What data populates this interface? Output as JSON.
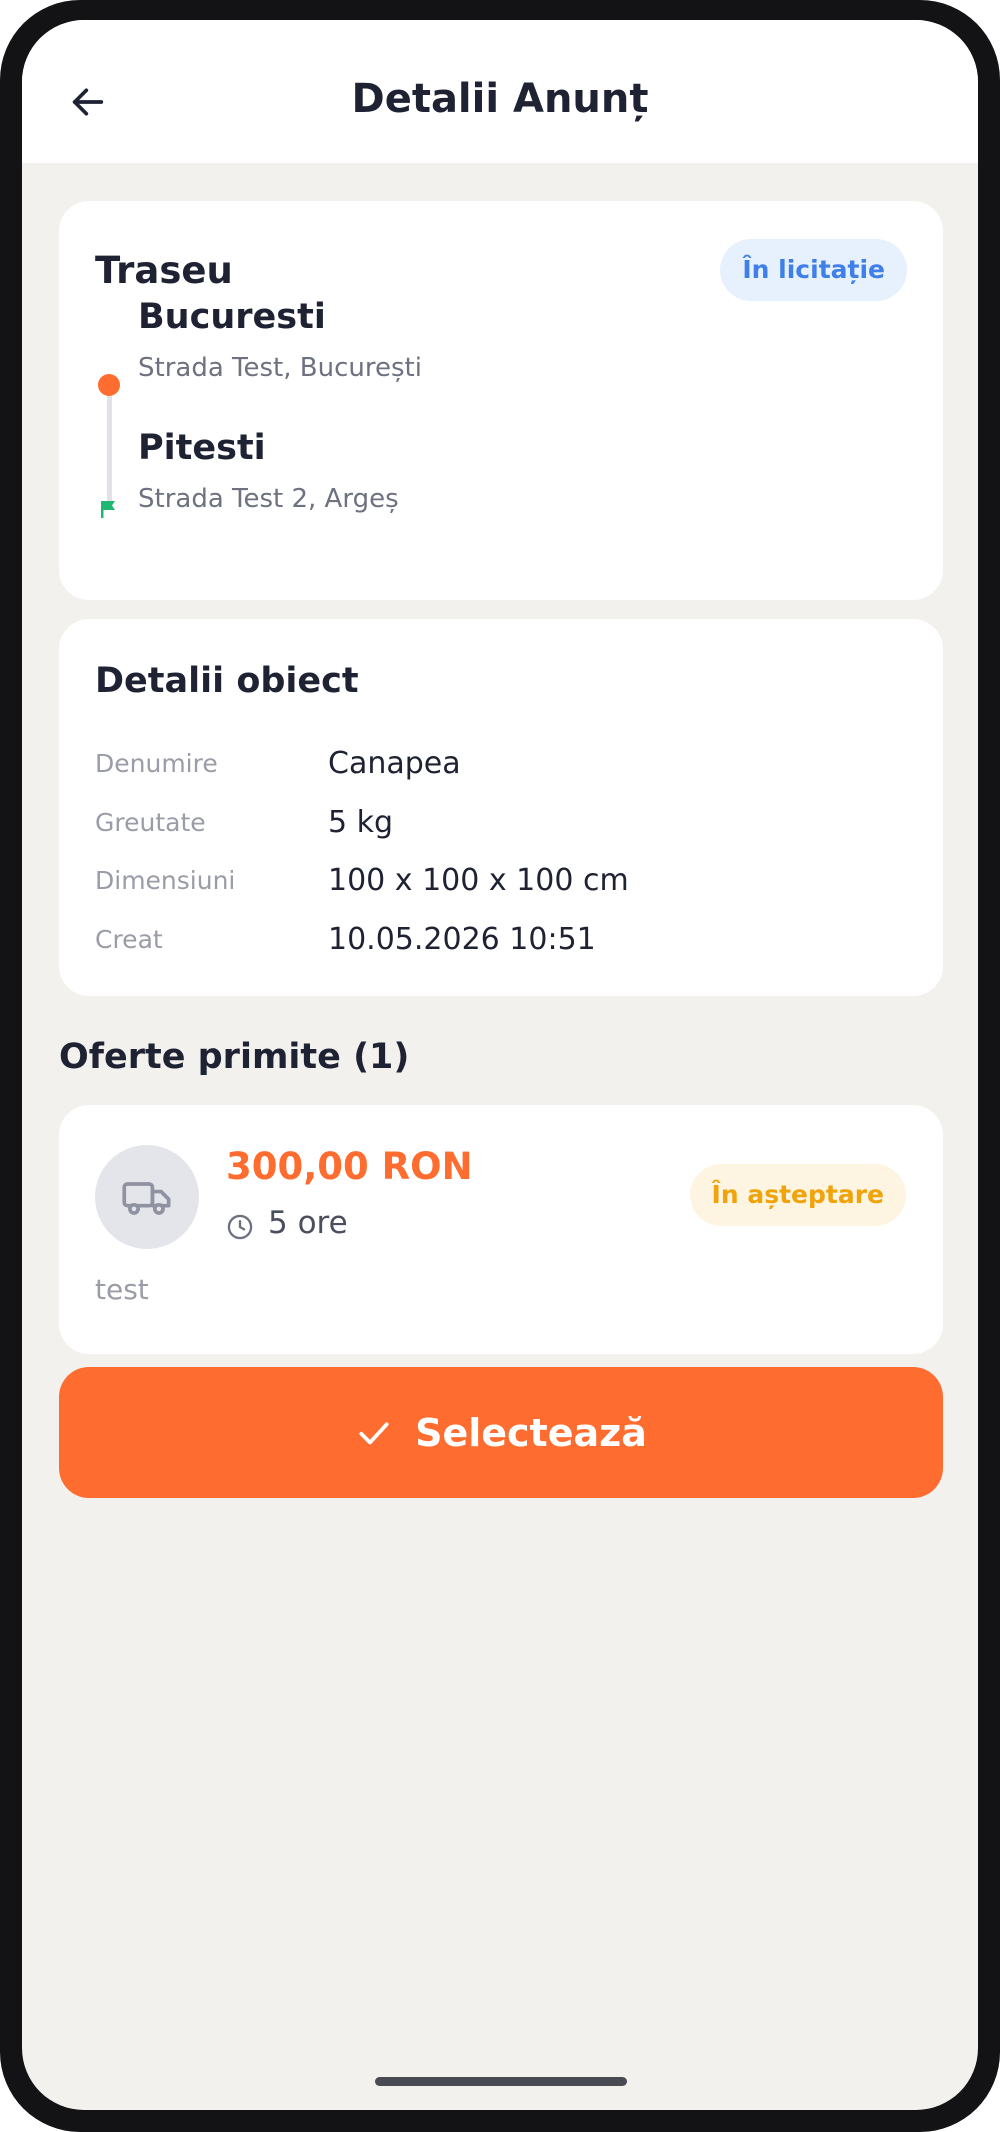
{
  "header": {
    "title": "Detalii Anunț",
    "back_icon": "arrow-left-icon"
  },
  "route": {
    "heading": "Traseu",
    "status_badge": "În licitație",
    "origin": {
      "city": "Bucuresti",
      "address": "Strada Test, București"
    },
    "destination": {
      "city": "Pitesti",
      "address": "Strada Test 2, Argeș"
    }
  },
  "object_details": {
    "heading": "Detalii obiect",
    "rows": [
      {
        "label": "Denumire",
        "value": "Canapea"
      },
      {
        "label": "Greutate",
        "value": "5 kg"
      },
      {
        "label": "Dimensiuni",
        "value": "100 x 100 x 100 cm"
      },
      {
        "label": "Creat",
        "value": "10.05.2026 10:51"
      }
    ]
  },
  "offers": {
    "heading": "Oferte primite (1)",
    "items": [
      {
        "price": "300,00 RON",
        "duration": "5 ore",
        "status": "În așteptare",
        "note": "test",
        "avatar_icon": "truck-icon"
      }
    ]
  },
  "select_button": {
    "label": "Selectează",
    "icon": "check-icon"
  },
  "colors": {
    "accent": "#ff6c2f",
    "auction_badge_bg": "#e7f0fd",
    "auction_badge_text": "#3f80e8",
    "waiting_badge_bg": "#fdf5e2",
    "waiting_badge_text": "#f0a30a",
    "destination_flag": "#1fb873",
    "background": "#f2f1ee"
  }
}
